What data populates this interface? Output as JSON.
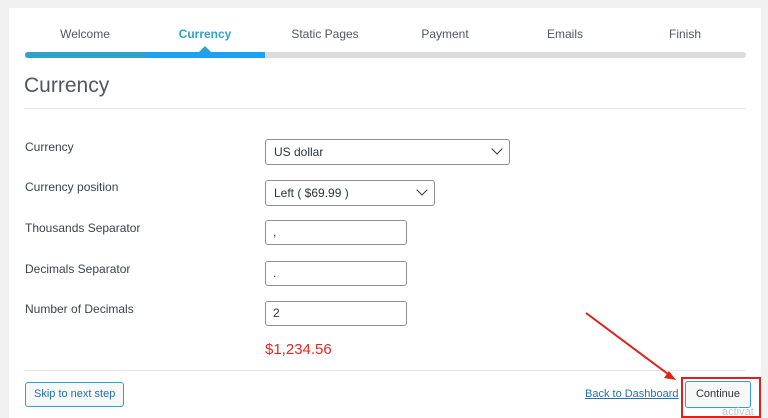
{
  "steps": [
    {
      "label": "Welcome"
    },
    {
      "label": "Currency"
    },
    {
      "label": "Static Pages"
    },
    {
      "label": "Payment"
    },
    {
      "label": "Emails"
    },
    {
      "label": "Finish"
    }
  ],
  "active_step": "Currency",
  "page_title": "Currency",
  "form": {
    "currency": {
      "label": "Currency",
      "value": "US dollar"
    },
    "position": {
      "label": "Currency position",
      "value": "Left ( $69.99 )"
    },
    "thousands": {
      "label": "Thousands Separator",
      "value": ","
    },
    "decimals_sep": {
      "label": "Decimals Separator",
      "value": "."
    },
    "num_decimals": {
      "label": "Number of Decimals",
      "value": "2"
    },
    "preview": "$1,234.56"
  },
  "footer": {
    "skip_label": "Skip to next step",
    "back_label": "Back to Dashboard",
    "continue_label": "Continue"
  },
  "corner_text": "activat",
  "colors": {
    "accent": "#2ea2cc",
    "preview_red": "#e3271e",
    "annotation_red": "#e0201b"
  }
}
